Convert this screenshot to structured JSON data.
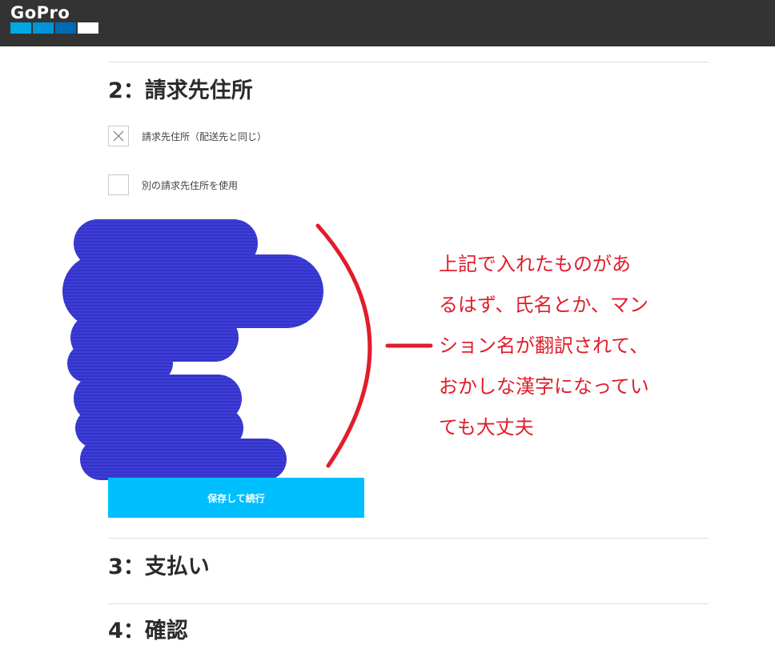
{
  "header": {
    "logo_text": "GoPro",
    "logo_colors": [
      "#00a8e1",
      "#0094d9",
      "#0069b3",
      "#ffffff"
    ]
  },
  "step2": {
    "title": "2：請求先住所",
    "same_address_label": "請求先住所（配送先と同じ）",
    "different_address_label": "別の請求先住所を使用",
    "continue_button_label": "保存して続行"
  },
  "step3": {
    "title": "3：支払い"
  },
  "step4": {
    "title": "4：確認"
  },
  "annotation": {
    "color": "#e11d2b",
    "lines": [
      "上記で入れたものがあ",
      "るはず、氏名とか、マン",
      "ション名が翻訳されて、",
      "おかしな漢字になってい",
      "ても大丈夫"
    ]
  },
  "redaction": {
    "color": "#3b3bd6"
  },
  "colors": {
    "topbar": "#333333",
    "button": "#00bfff"
  }
}
